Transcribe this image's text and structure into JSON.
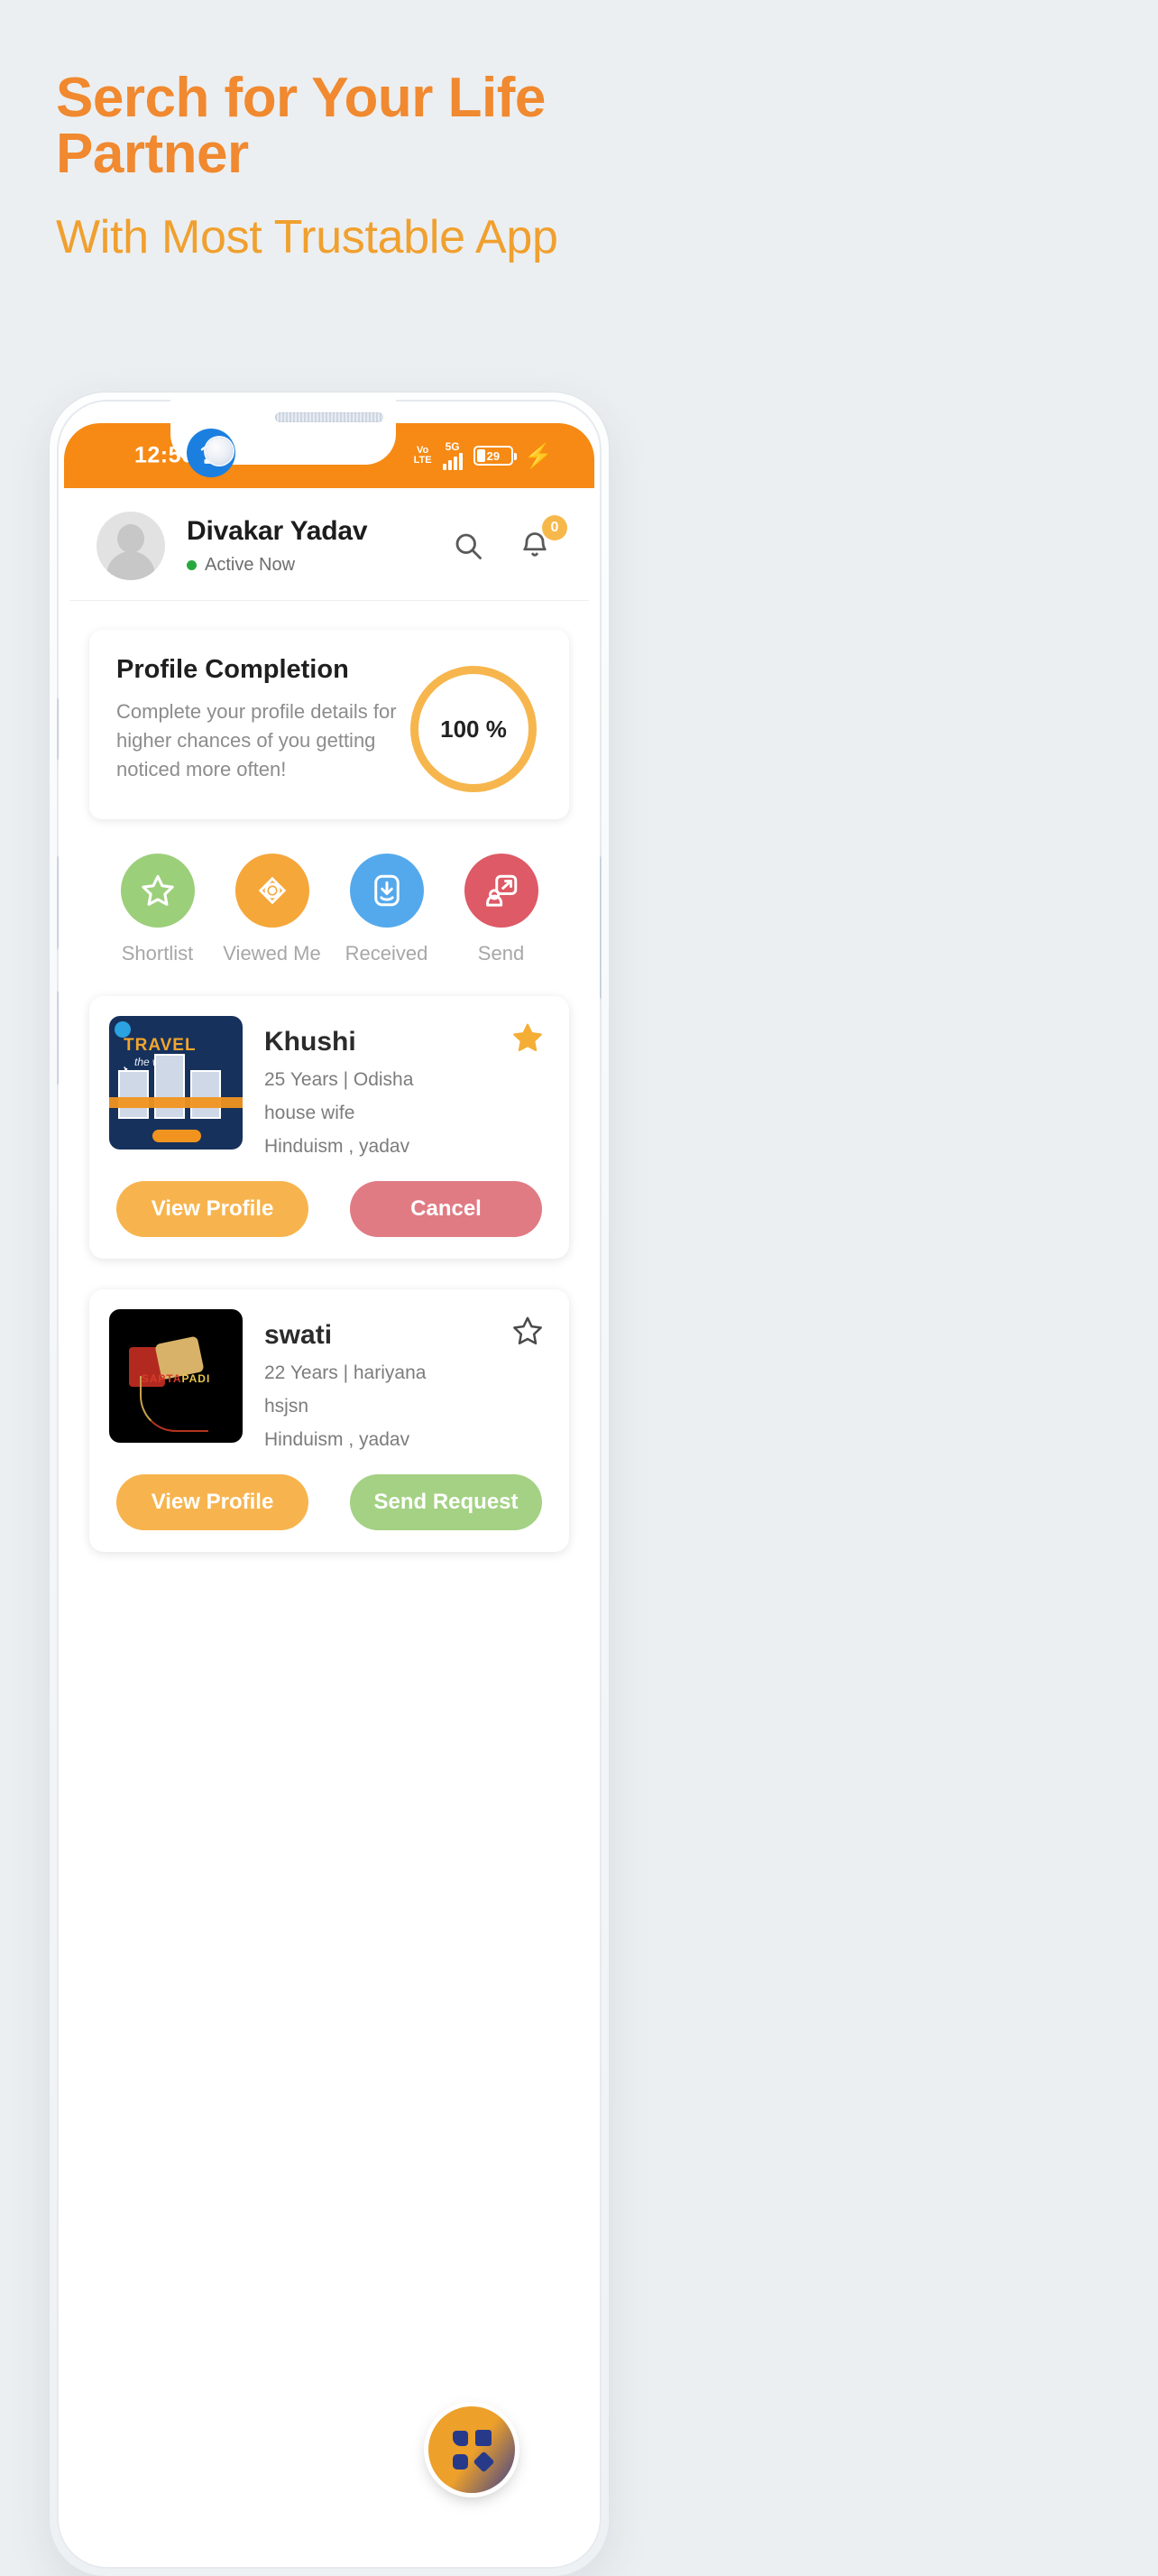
{
  "promo": {
    "headline": "Serch for Your Life Partner",
    "subheadline": "With Most Trustable App",
    "headline_color": "#f0892f",
    "subheadline_color": "#f0a02f",
    "background_color": "#eceff1"
  },
  "status_bar": {
    "time": "12:56",
    "volte_line1": "Vo",
    "volte_line2": "LTE",
    "network": "5G",
    "battery_percent": "29",
    "charging_icon": "bolt-icon",
    "wifi_icon": "wifi-hotspot-icon",
    "background_color": "#f68a14"
  },
  "app_header": {
    "user_name": "Divakar Yadav",
    "status_text": "Active Now",
    "status_dot_color": "#27a83d",
    "search_icon": "search-icon",
    "bell_icon": "bell-icon",
    "notification_count": "0",
    "badge_color": "#f7b84b"
  },
  "profile_completion": {
    "title": "Profile Completion",
    "description": "Complete your profile details for higher chances of you getting noticed more often!",
    "percent_label": "100 %",
    "ring_color": "#f6b64d"
  },
  "quick_actions": [
    {
      "label": "Shortlist",
      "icon": "star-outline-icon",
      "color": "#9ccf7a"
    },
    {
      "label": "Viewed Me",
      "icon": "eye-icon",
      "color": "#f5a73a"
    },
    {
      "label": "Received",
      "icon": "inbox-download-icon",
      "color": "#54a9ec"
    },
    {
      "label": "Send",
      "icon": "send-request-icon",
      "color": "#dd5a66"
    }
  ],
  "profiles": [
    {
      "name": "Khushi",
      "details": "25  Years  |  Odisha",
      "occupation": "house wife",
      "religion": "Hinduism , yadav",
      "starred": true,
      "star_icon": "star-filled-icon",
      "thumbnail": "travel-the-world-poster",
      "thumb_title": "TRAVEL",
      "thumb_subtitle": "the world",
      "primary_button": "View Profile",
      "secondary_button": "Cancel",
      "secondary_color": "#e07b84"
    },
    {
      "name": "swati",
      "details": "22  Years  |  hariyana",
      "occupation": "hsjsn",
      "religion": "Hinduism , yadav",
      "starred": false,
      "star_icon": "star-outline-icon",
      "thumbnail": "saptapadi-poster",
      "thumb_title": "SAPTAPADI",
      "primary_button": "View Profile",
      "secondary_button": "Send Request",
      "secondary_color": "#a4d183"
    }
  ],
  "fab": {
    "icon": "apps-grid-icon",
    "label": "menu"
  }
}
